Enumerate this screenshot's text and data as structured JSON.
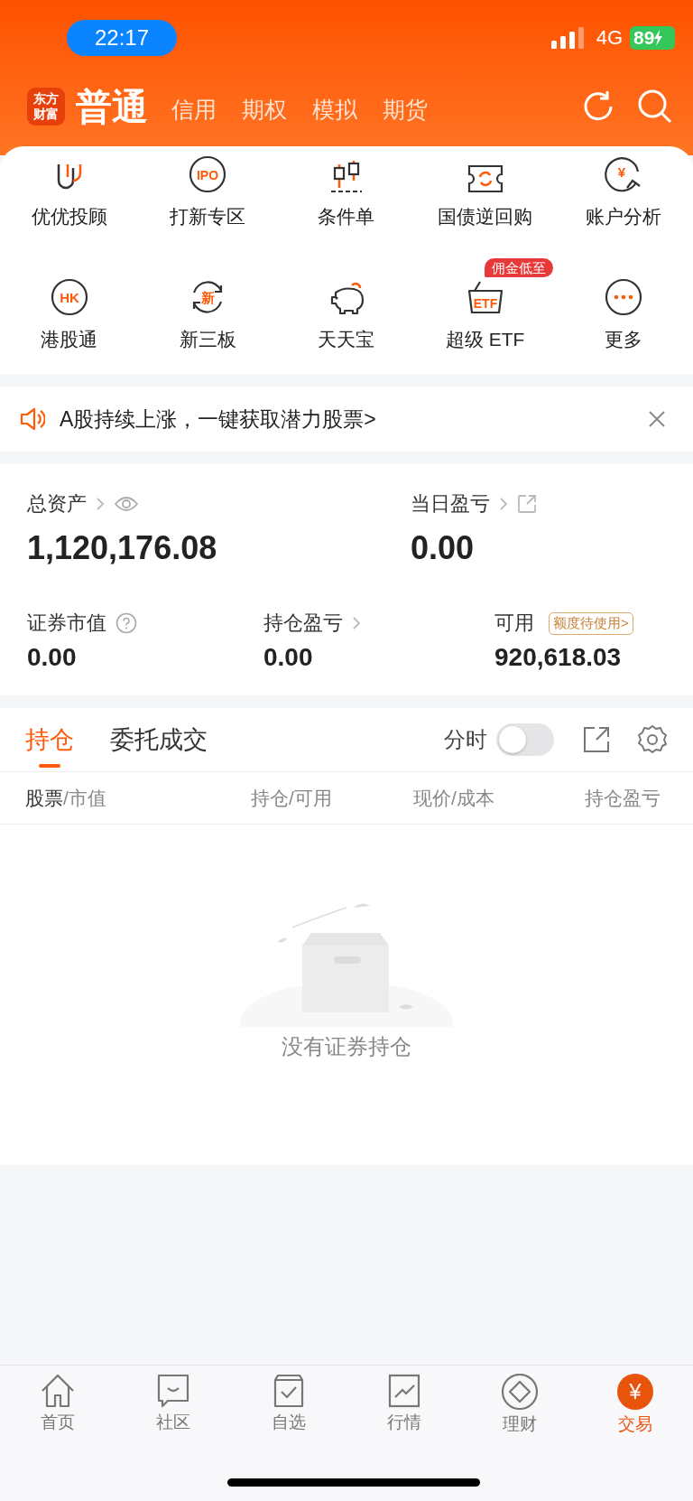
{
  "status_bar": {
    "time": "22:17",
    "network": "4G",
    "battery": "89"
  },
  "header": {
    "logo": "东方财富",
    "tabs": [
      {
        "label": "普通",
        "selected": true
      },
      {
        "label": "信用",
        "selected": false
      },
      {
        "label": "期权",
        "selected": false
      },
      {
        "label": "模拟",
        "selected": false
      },
      {
        "label": "期货",
        "selected": false
      }
    ]
  },
  "shortcuts": [
    {
      "label": "优优投顾"
    },
    {
      "label": "打新专区",
      "icon_text": "IPO"
    },
    {
      "label": "条件单"
    },
    {
      "label": "国债逆回购"
    },
    {
      "label": "账户分析",
      "icon_text": "¥"
    },
    {
      "label": "港股通",
      "icon_text": "HK"
    },
    {
      "label": "新三板",
      "icon_text": "新"
    },
    {
      "label": "天天宝"
    },
    {
      "label": "超级 ETF",
      "icon_text": "ETF",
      "badge": "佣金低至"
    },
    {
      "label": "更多"
    }
  ],
  "notice": {
    "text": "A股持续上涨，一键获取潜力股票>"
  },
  "assets": [
    {
      "label": "总资产",
      "value": "1,120,176.08"
    },
    {
      "label": "当日盈亏",
      "value": "0.00"
    },
    {
      "label": "证券市值",
      "value": "0.00"
    },
    {
      "label": "持仓盈亏",
      "value": "0.00"
    },
    {
      "label": "可用",
      "value": "920,618.03",
      "badge": "额度待使用>"
    }
  ],
  "holdings": {
    "tabs": [
      {
        "label": "持仓",
        "selected": true
      },
      {
        "label": "委托成交",
        "selected": false
      }
    ],
    "intraday": {
      "label": "分时",
      "on": false
    },
    "columns": [
      {
        "label": "股票",
        "sub": "/市值"
      },
      {
        "label": "持仓",
        "sub": "/可用"
      },
      {
        "label": "现价",
        "sub": "/成本"
      },
      {
        "label": "持仓盈亏"
      }
    ],
    "empty_text": "没有证券持仓"
  },
  "bottom_nav": [
    {
      "label": "首页",
      "selected": false
    },
    {
      "label": "社区",
      "selected": false
    },
    {
      "label": "自选",
      "selected": false
    },
    {
      "label": "行情",
      "selected": false
    },
    {
      "label": "理财",
      "selected": false
    },
    {
      "label": "交易",
      "icon_text": "¥",
      "selected": true
    }
  ]
}
